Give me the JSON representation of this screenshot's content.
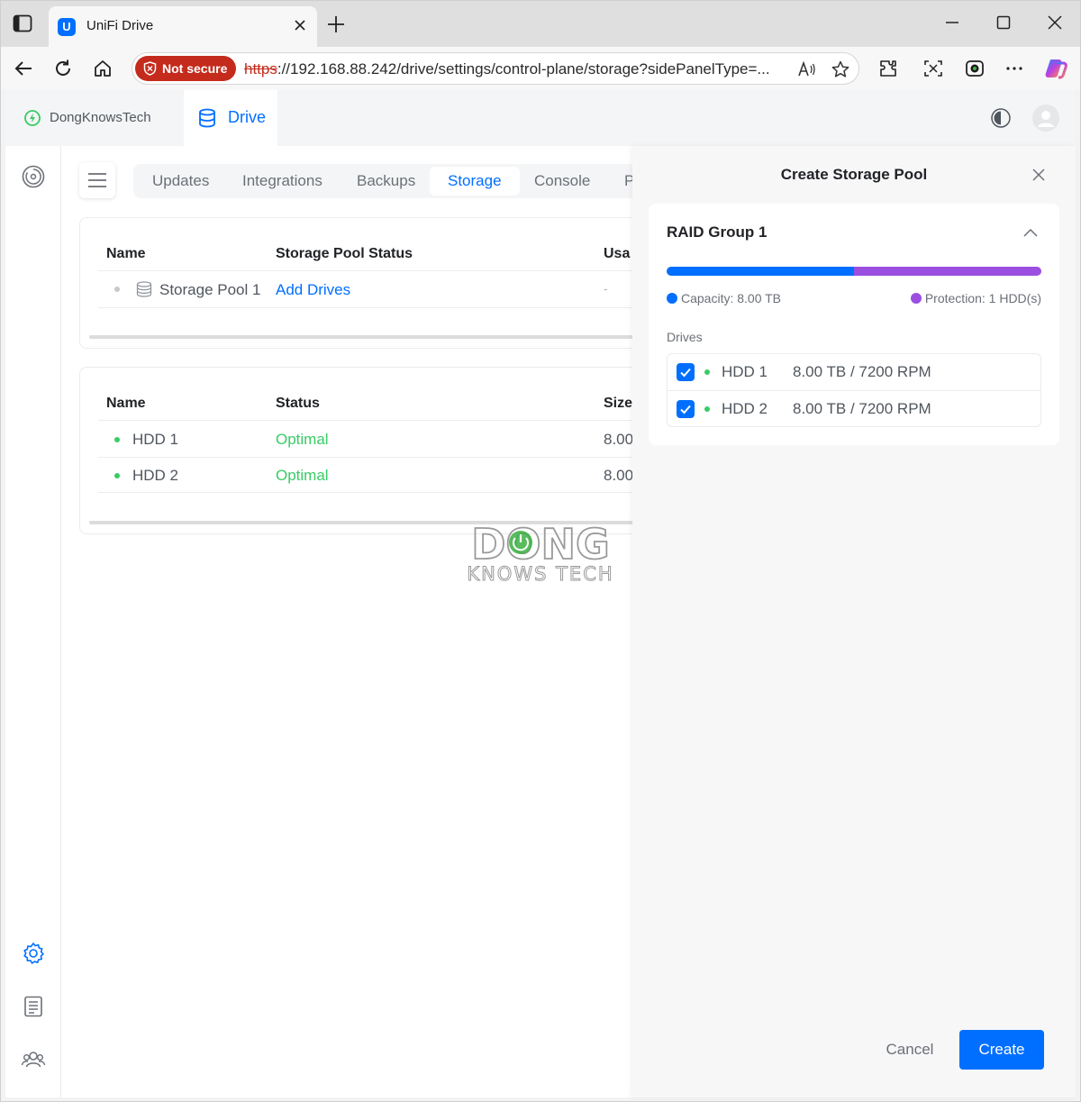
{
  "browser": {
    "tab_title": "UniFi Drive",
    "favicon_letter": "U",
    "url_protocol": "https",
    "url_rest": "://192.168.88.242/drive/settings/control-plane/storage?sidePanelType=...",
    "security_label": "Not secure",
    "icons": [
      "sidebar-icon",
      "close-icon",
      "plus-icon",
      "minimize-icon",
      "maximize-icon",
      "back-icon",
      "reload-icon",
      "home-icon",
      "read-aloud-icon",
      "favorite-star-icon",
      "extensions-icon",
      "screenshot-icon",
      "camera-icon",
      "more-icon",
      "copilot-icon"
    ]
  },
  "app_header": {
    "site_name": "DongKnowsTech",
    "app_name": "Drive"
  },
  "settings_tabs": [
    {
      "label": "Updates"
    },
    {
      "label": "Integrations"
    },
    {
      "label": "Backups"
    },
    {
      "label": "Storage",
      "active": true
    },
    {
      "label": "Console"
    },
    {
      "label": "P"
    }
  ],
  "pools_table": {
    "headers": {
      "name": "Name",
      "status": "Storage Pool Status",
      "usage": "Usa"
    },
    "rows": [
      {
        "name": "Storage Pool 1",
        "status_link": "Add Drives",
        "usage": "-"
      }
    ]
  },
  "drives_table": {
    "headers": {
      "name": "Name",
      "status": "Status",
      "size": "Size"
    },
    "rows": [
      {
        "name": "HDD 1",
        "status": "Optimal",
        "size": "8.00"
      },
      {
        "name": "HDD 2",
        "status": "Optimal",
        "size": "8.00"
      }
    ]
  },
  "watermark": {
    "line1": "DONG",
    "line2": "KNOWS TECH"
  },
  "panel": {
    "title": "Create Storage Pool",
    "raid_group": {
      "title": "RAID Group 1",
      "capacity_fraction": 0.5,
      "capacity_label": "Capacity: 8.00 TB",
      "protection_label": "Protection: 1 HDD(s)",
      "drives_label": "Drives",
      "drives": [
        {
          "name": "HDD 1",
          "spec": "8.00 TB / 7200 RPM",
          "checked": true
        },
        {
          "name": "HDD 2",
          "spec": "8.00 TB / 7200 RPM",
          "checked": true
        }
      ]
    },
    "cancel_label": "Cancel",
    "create_label": "Create"
  },
  "colors": {
    "accent": "#006fff",
    "protection": "#9b4fe0",
    "optimal": "#38cc65",
    "not_secure": "#c42b1c"
  }
}
